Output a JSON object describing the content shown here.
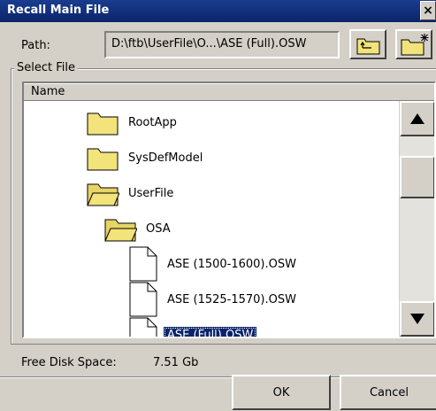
{
  "window": {
    "title": "Recall Main File",
    "close_glyph": "×"
  },
  "path": {
    "label": "Path:",
    "value": "D:\\ftb\\UserFile\\O...\\ASE (Full).OSW"
  },
  "toolbar": {
    "up_folder_icon": "folder-up-icon",
    "new_folder_icon": "new-folder-icon"
  },
  "select_file": {
    "group_label": "Select File",
    "column_header": "Name",
    "items": [
      {
        "label": "RootApp",
        "type": "folder",
        "state": "closed"
      },
      {
        "label": "SysDefModel",
        "type": "folder",
        "state": "closed"
      },
      {
        "label": "UserFile",
        "type": "folder",
        "state": "open"
      },
      {
        "label": "OSA",
        "type": "folder",
        "state": "open"
      },
      {
        "label": "ASE (1500-1600).OSW",
        "type": "file"
      },
      {
        "label": "ASE (1525-1570).OSW",
        "type": "file"
      },
      {
        "label": "ASE (Full).OSW",
        "type": "file",
        "selected": true
      }
    ]
  },
  "status": {
    "free_label": "Free Disk Space:",
    "free_value": "7.51 Gb"
  },
  "buttons": {
    "ok": "OK",
    "cancel": "Cancel"
  },
  "colors": {
    "title_bar": "#0a246a",
    "selection": "#0a246a",
    "folder": "#f2e37a",
    "face": "#d4d0c8"
  }
}
